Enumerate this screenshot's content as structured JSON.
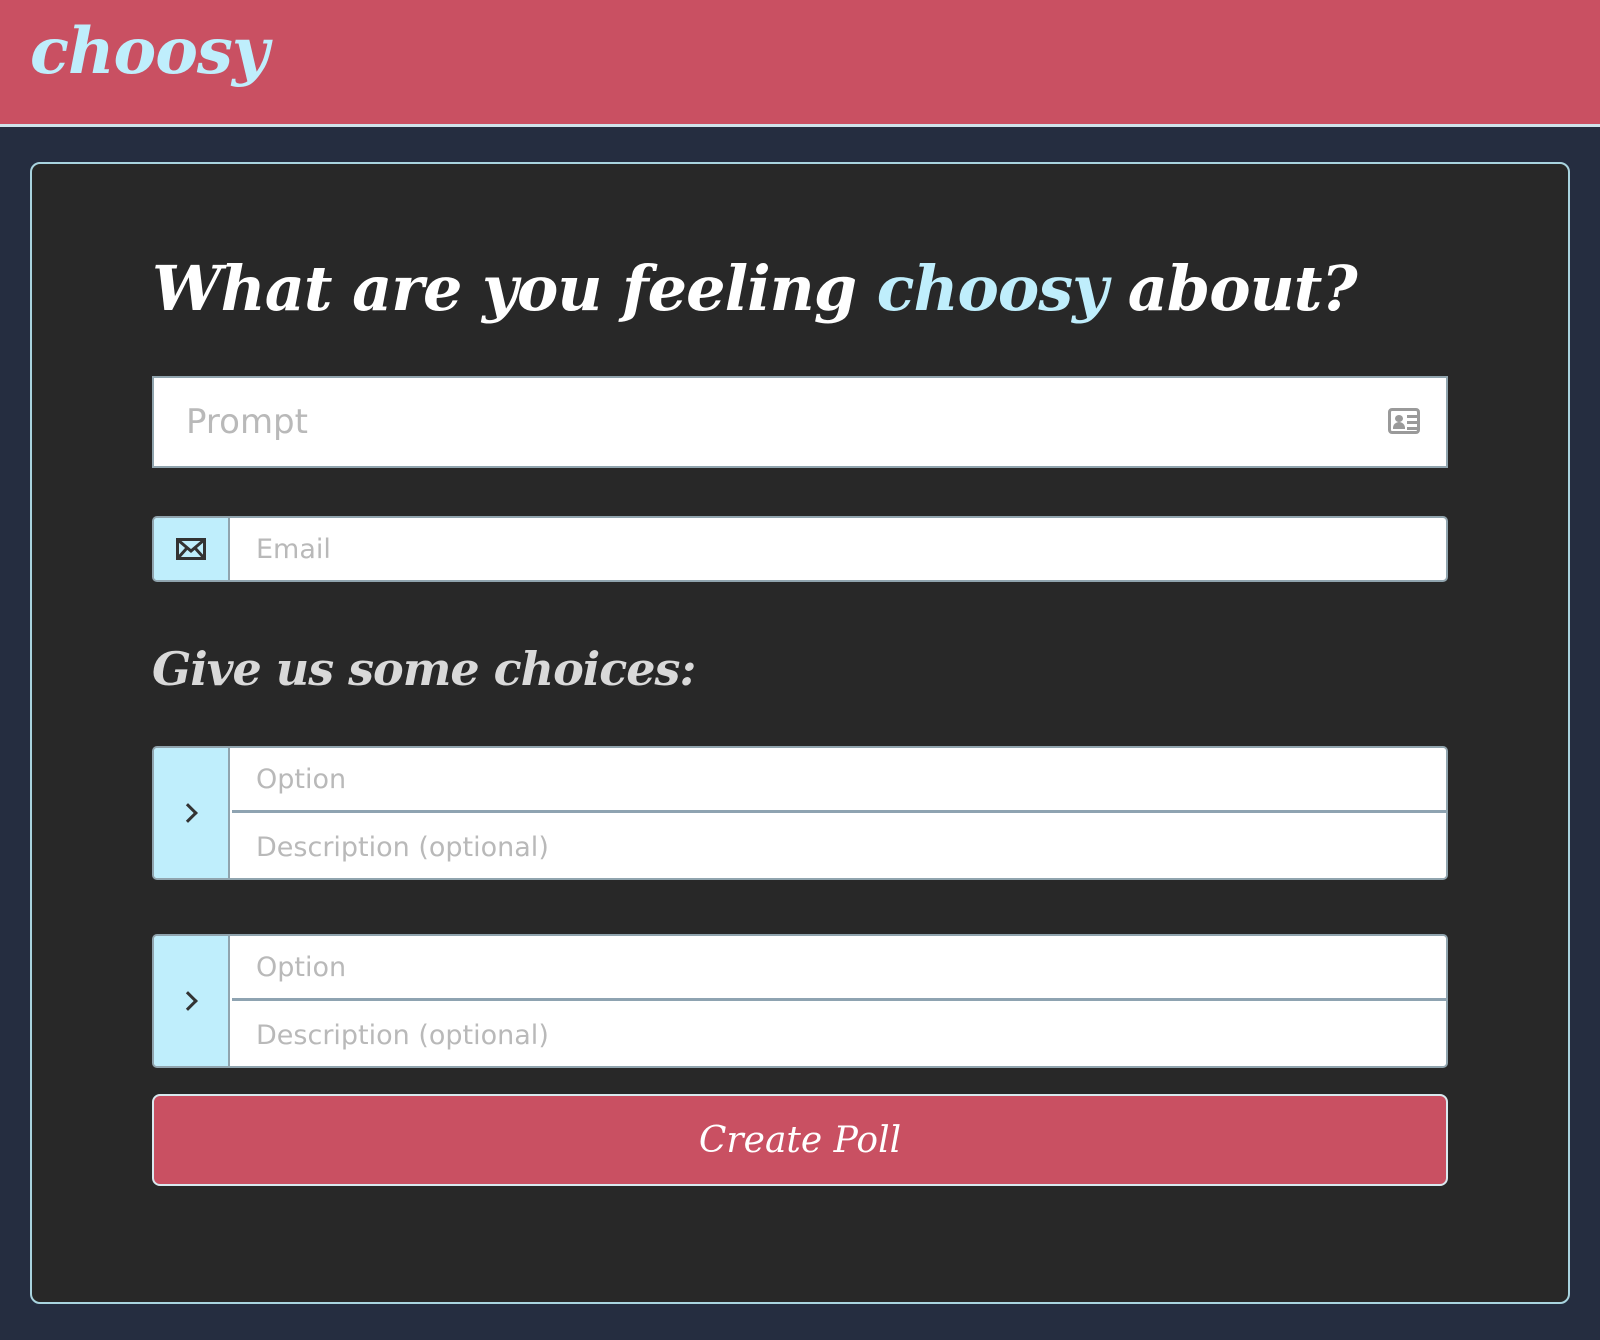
{
  "header": {
    "brand": "choosy"
  },
  "form": {
    "heading_prefix": "What are you feeling ",
    "heading_accent": "choosy",
    "heading_suffix": " about?",
    "prompt": {
      "placeholder": "Prompt",
      "value": "",
      "icon": "contact-card-icon"
    },
    "email": {
      "placeholder": "Email",
      "value": "",
      "icon": "envelope-icon"
    },
    "choices_heading": "Give us some choices:",
    "choices": [
      {
        "option_placeholder": "Option",
        "description_placeholder": "Description (optional)",
        "icon": "chevron-right-icon"
      },
      {
        "option_placeholder": "Option",
        "description_placeholder": "Description (optional)",
        "icon": "chevron-right-icon"
      }
    ],
    "submit_label": "Create Poll"
  },
  "colors": {
    "brand_red": "#c95062",
    "accent_cyan": "#bfeefc",
    "page_bg": "#252d40",
    "card_bg": "#282828"
  }
}
